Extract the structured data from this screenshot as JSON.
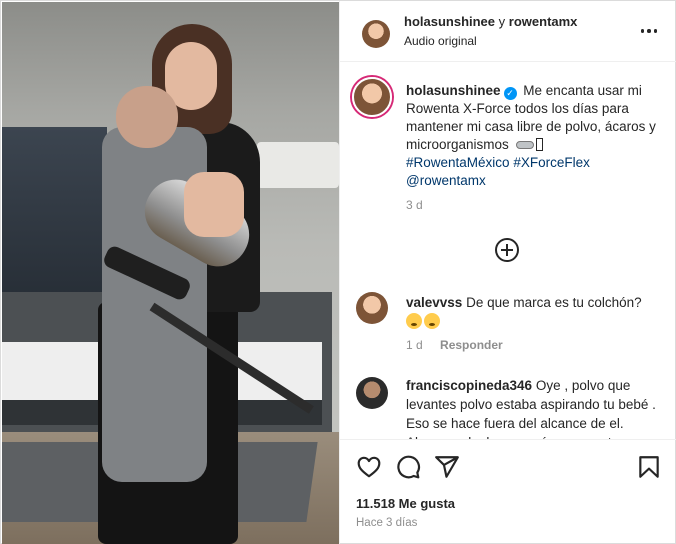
{
  "post": {
    "header": {
      "account_primary": "holasunshinee",
      "joiner": "y",
      "account_secondary": "rowentamx",
      "audio": "Audio original"
    },
    "caption": {
      "username": "holasunshinee",
      "text": "Me encanta usar mi Rowenta X-Force todos los días para mantener mi casa libre de polvo, ácaros y microorganismos",
      "hashtag_1": "#RowentaMéxico",
      "hashtag_2": "#XForceFlex",
      "mention": "@rowentamx",
      "time": "3 d"
    },
    "comments": [
      {
        "username": "valevvss",
        "text": "De que marca es tu colchón?",
        "time": "1 d",
        "reply_label": "Responder"
      },
      {
        "username": "franciscopineda346",
        "text": "Oye , polvo que levantes polvo estaba aspirando tu bebé . Eso se hace fuera del alcance de el. Abggggg donles una cámara a esta"
      }
    ],
    "actions": {
      "likes": "11.518 Me gusta",
      "posted": "Hace 3 días"
    }
  },
  "icons": {
    "more": "more-options-icon",
    "add_comments": "plus-circle-icon",
    "like": "heart-icon",
    "comment": "comment-icon",
    "share": "send-icon",
    "save": "bookmark-icon",
    "verified": "verified-badge-icon"
  },
  "colors": {
    "link": "#00376b",
    "verified": "#0095f6",
    "story_ring": "#d62976",
    "muted_text": "#8e8e8e"
  }
}
